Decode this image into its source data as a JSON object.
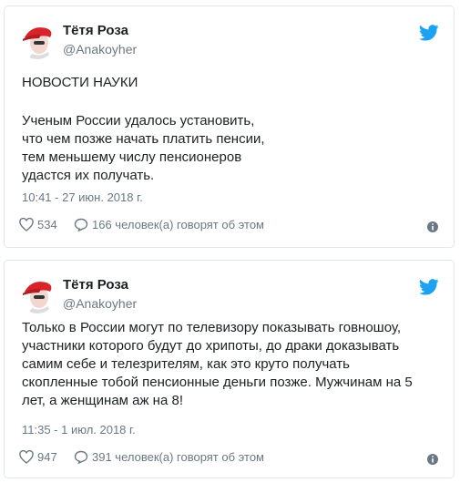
{
  "tweets": [
    {
      "name": "Тётя Роза",
      "handle": "@Anakoyher",
      "headline": "НОВОСТИ НАУКИ",
      "text": "Ученым России удалось установить,\nчто чем позже начать платить пенсии,\nтем меньшему числу пенсионеров\nудастся их получать.",
      "date": "10:41 - 27 июн. 2018 г.",
      "likes": "534",
      "talking": "166 человек(а) говорят об этом"
    },
    {
      "name": "Тётя Роза",
      "handle": "@Anakoyher",
      "text": "Только в России могут по телевизору показывать говношоу,\nучастники которого будут до хрипоты, до драки доказывать\nсамим себе и телезрителям, как это круто получать\nскопленные тобой пенсионные деньги позже. Мужчинам на 5\nлет, а женщинам аж на 8!",
      "date": "11:35 - 1 июл. 2018 г.",
      "likes": "947",
      "talking": "391 человек(а) говорят об этом"
    }
  ],
  "colors": {
    "twitter_blue": "#1da1f2",
    "muted": "#697882",
    "border": "#e1e8ed",
    "avatar_red": "#d8232a"
  }
}
